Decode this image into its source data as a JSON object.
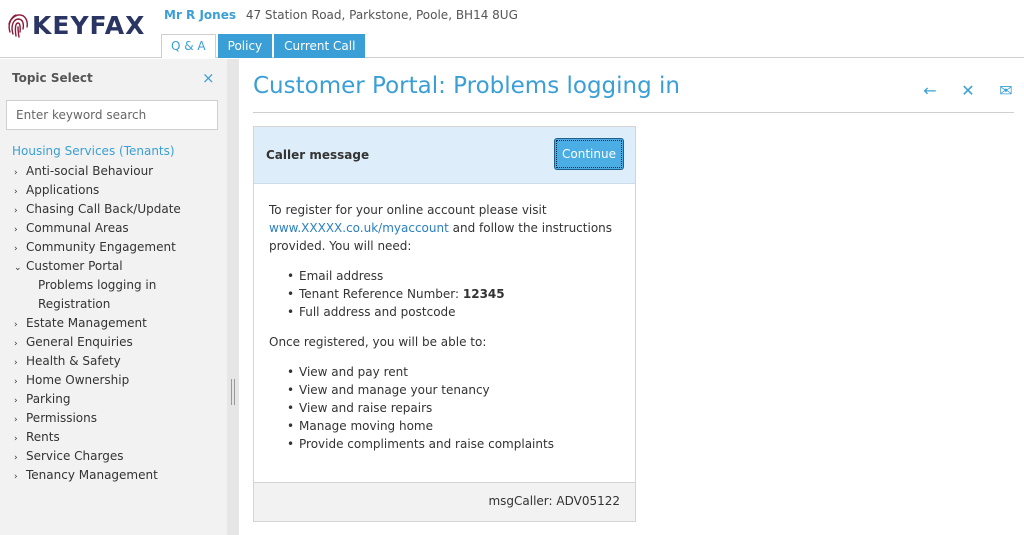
{
  "header": {
    "logo_text": "KEYFAX",
    "caller_name": "Mr R Jones",
    "caller_address": "47 Station Road, Parkstone, Poole, BH14 8UG",
    "tabs": [
      {
        "label": "Q & A"
      },
      {
        "label": "Policy"
      },
      {
        "label": "Current Call"
      }
    ]
  },
  "sidebar": {
    "title": "Topic Select",
    "close_icon": "×",
    "search_placeholder": "Enter keyword search",
    "section": "Housing Services (Tenants)",
    "items": [
      {
        "label": "Anti-social Behaviour",
        "chev": "›"
      },
      {
        "label": "Applications",
        "chev": "›"
      },
      {
        "label": "Chasing Call Back/Update",
        "chev": "›"
      },
      {
        "label": "Communal Areas",
        "chev": "›"
      },
      {
        "label": "Community Engagement",
        "chev": "›"
      },
      {
        "label": "Customer Portal",
        "chev": "⌄"
      },
      {
        "label": "Problems logging in"
      },
      {
        "label": "Registration"
      },
      {
        "label": "Estate Management",
        "chev": "›"
      },
      {
        "label": "General Enquiries",
        "chev": "›"
      },
      {
        "label": "Health & Safety",
        "chev": "›"
      },
      {
        "label": "Home Ownership",
        "chev": "›"
      },
      {
        "label": "Parking",
        "chev": "›"
      },
      {
        "label": "Permissions",
        "chev": "›"
      },
      {
        "label": "Rents",
        "chev": "›"
      },
      {
        "label": "Service Charges",
        "chev": "›"
      },
      {
        "label": "Tenancy Management",
        "chev": "›"
      }
    ]
  },
  "main": {
    "title": "Customer Portal: Problems logging in",
    "actions": {
      "back_icon": "←",
      "close_icon": "✕",
      "email_icon": "✉"
    },
    "card": {
      "header": "Caller message",
      "continue_label": "Continue",
      "intro_pre": "To register for your online account please visit",
      "link": "www.XXXXX.co.uk/myaccount",
      "intro_post": "and follow the instructions provided. You will need:",
      "needs": [
        {
          "text": "Email address"
        },
        {
          "text": "Tenant Reference Number:",
          "bold": "12345"
        },
        {
          "text": "Full address and postcode"
        }
      ],
      "once_text": "Once registered, you will be able to:",
      "abilities": [
        "View and pay rent",
        "View and manage your tenancy",
        "View and raise repairs",
        "Manage moving home",
        "Provide compliments and raise complaints"
      ],
      "footer": "msgCaller: ADV05122"
    }
  },
  "colors": {
    "accent": "#3a9fd6",
    "logo": "#2a3563",
    "logo_mark": "#8b1a3a",
    "card_header_bg": "#ddeefa",
    "sidebar_bg": "#f2f2f2"
  }
}
